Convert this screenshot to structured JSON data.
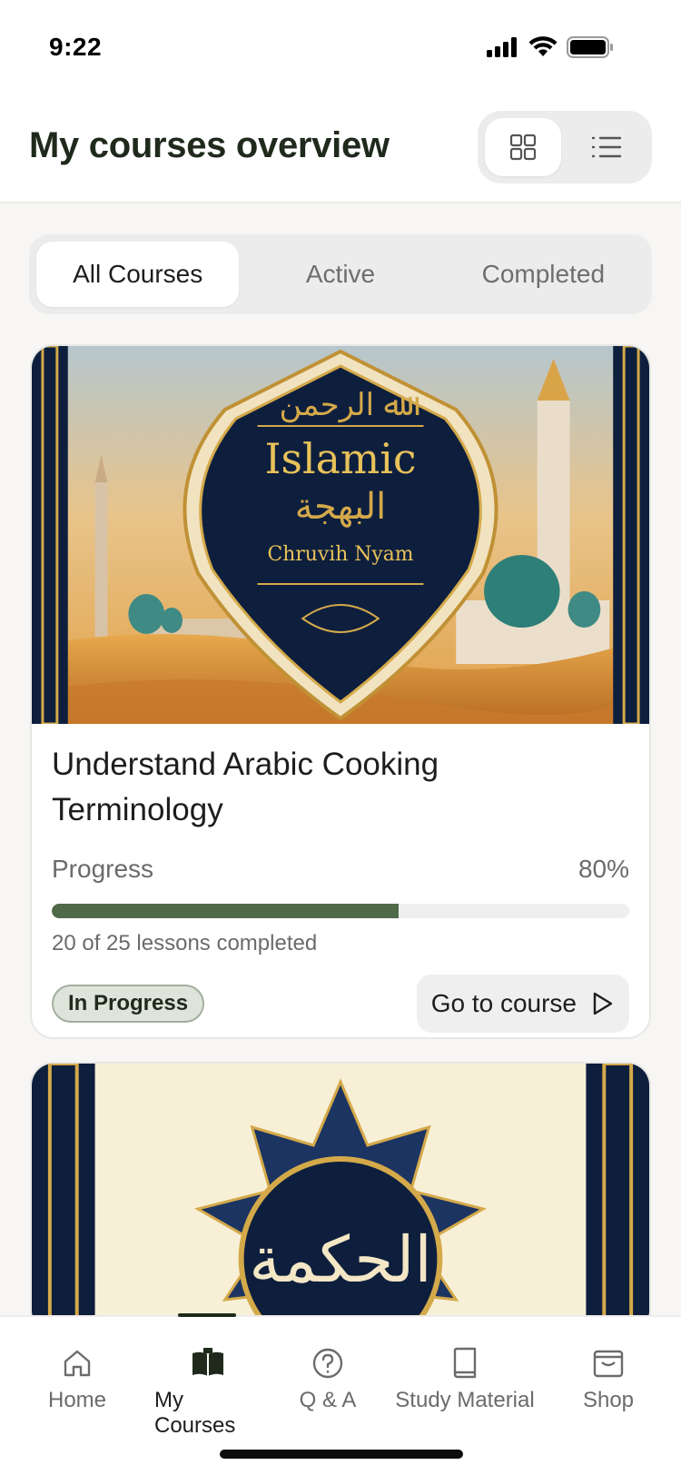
{
  "status_bar": {
    "time": "9:22"
  },
  "header": {
    "title": "My courses overview"
  },
  "tabs": [
    {
      "label": "All Courses",
      "active": true
    },
    {
      "label": "Active",
      "active": false
    },
    {
      "label": "Completed",
      "active": false
    }
  ],
  "courses": [
    {
      "cover_texts": [
        "Islamic",
        "Chruvih Nyam"
      ],
      "title": "Understand Arabic Cooking Terminology",
      "progress_label": "Progress",
      "progress_percent_text": "80%",
      "progress_value": 0.6,
      "lessons_text": "20 of 25 lessons completed",
      "status": "In Progress",
      "cta_label": "Go to course"
    },
    {
      "cover_texts": []
    }
  ],
  "bottom_nav": [
    {
      "label": "Home",
      "icon": "home-icon"
    },
    {
      "label": "My Courses",
      "icon": "book-open-icon",
      "active": true
    },
    {
      "label": "Q & A",
      "icon": "question-circle-icon"
    },
    {
      "label": "Study Material",
      "icon": "book-icon"
    },
    {
      "label": "Shop",
      "icon": "shopping-bag-icon"
    }
  ],
  "colors": {
    "accent": "#4f6a48",
    "title_dark": "#1f2a1c",
    "navy": "#0e1f3d",
    "gold": "#d4a94a",
    "sky": "#e6b25a"
  }
}
